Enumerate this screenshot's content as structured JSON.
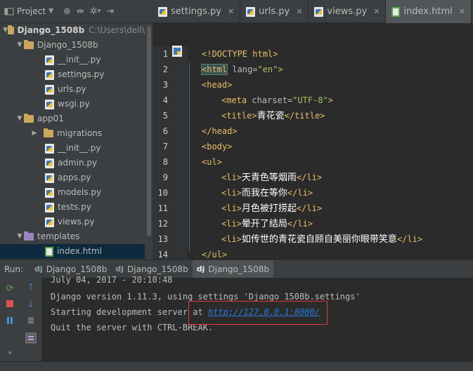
{
  "project": {
    "selector_label": "Project",
    "tree": [
      {
        "label": "Django_1508b",
        "path": "C:\\Users\\dell\\",
        "bold": true
      },
      {
        "label": "Django_1508b"
      },
      {
        "label": "__init__.py"
      },
      {
        "label": "settings.py"
      },
      {
        "label": "urls.py"
      },
      {
        "label": "wsgi.py"
      },
      {
        "label": "app01"
      },
      {
        "label": "migrations"
      },
      {
        "label": "__init__.py"
      },
      {
        "label": "admin.py"
      },
      {
        "label": "apps.py"
      },
      {
        "label": "models.py"
      },
      {
        "label": "tests.py"
      },
      {
        "label": "views.py"
      },
      {
        "label": "templates"
      },
      {
        "label": "index.html"
      }
    ]
  },
  "editor": {
    "tabs": [
      {
        "label": "settings.py"
      },
      {
        "label": "urls.py"
      },
      {
        "label": "views.py"
      },
      {
        "label": "index.html"
      }
    ],
    "line_numbers": [
      "1",
      "2",
      "3",
      "4",
      "5",
      "6",
      "7",
      "8",
      "9",
      "10",
      "11",
      "12",
      "13",
      "14"
    ],
    "code": {
      "l1": "<!DOCTYPE html>",
      "l2_open": "<html",
      "l2_attr": " lang=",
      "l2_val": "\"en\"",
      "l2_close": ">",
      "l3": "<head>",
      "l4_open": "<meta",
      "l4_attr": " charset=",
      "l4_val": "\"UTF-8\"",
      "l4_close": ">",
      "l5_open": "<title>",
      "l5_text": "青花瓷",
      "l5_close": "</title>",
      "l6": "</head>",
      "l7": "<body>",
      "l8": "<ul>",
      "li_open": "<li>",
      "li_close": "</li>",
      "l9_text": "天青色等烟雨",
      "l10_text": "而我在等你",
      "l11_text": "月色被打捞起",
      "l12_text": "晕开了结局",
      "l13_text": "如传世的青花瓷自顾自美丽你眼带笑意",
      "l14": "</ul>"
    }
  },
  "run": {
    "label": "Run:",
    "tabs": [
      {
        "label": "Django_1508b"
      },
      {
        "label": "Django_1508b"
      },
      {
        "label": "Django_1508b"
      }
    ],
    "console": {
      "line1": "July 04, 2017 - 20:10:48",
      "line2": "Django version 1.11.3, using settings 'Django_1508b.settings'",
      "line3_prefix": "Starting development server at ",
      "line3_link": "http://127.0.0.1:8000/",
      "line4": "Quit the server with CTRL-BREAK."
    }
  }
}
